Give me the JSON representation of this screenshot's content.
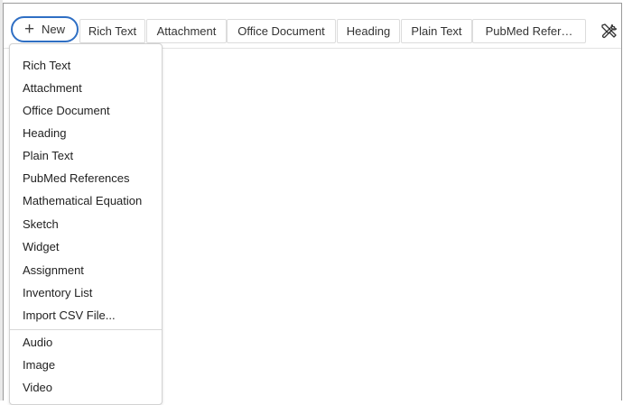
{
  "toolbar": {
    "new_label": "New",
    "tabs": [
      {
        "label": "Rich Text"
      },
      {
        "label": "Attachment"
      },
      {
        "label": "Office Document"
      },
      {
        "label": "Heading"
      },
      {
        "label": "Plain Text"
      },
      {
        "label": "PubMed Refer…"
      }
    ],
    "tools_icon": "tools-icon"
  },
  "new_menu": {
    "items": [
      {
        "label": "Rich Text"
      },
      {
        "label": "Attachment"
      },
      {
        "label": "Office Document"
      },
      {
        "label": "Heading"
      },
      {
        "label": "Plain Text"
      },
      {
        "label": "PubMed References"
      },
      {
        "label": "Mathematical Equation"
      },
      {
        "label": "Sketch"
      },
      {
        "label": "Widget"
      },
      {
        "label": "Assignment"
      },
      {
        "label": "Inventory List"
      },
      {
        "label": "Import CSV File..."
      }
    ],
    "media_items": [
      {
        "label": "Audio"
      },
      {
        "label": "Image"
      },
      {
        "label": "Video"
      }
    ]
  },
  "colors": {
    "accent": "#2f6fc4",
    "border": "#dcdcdc"
  }
}
